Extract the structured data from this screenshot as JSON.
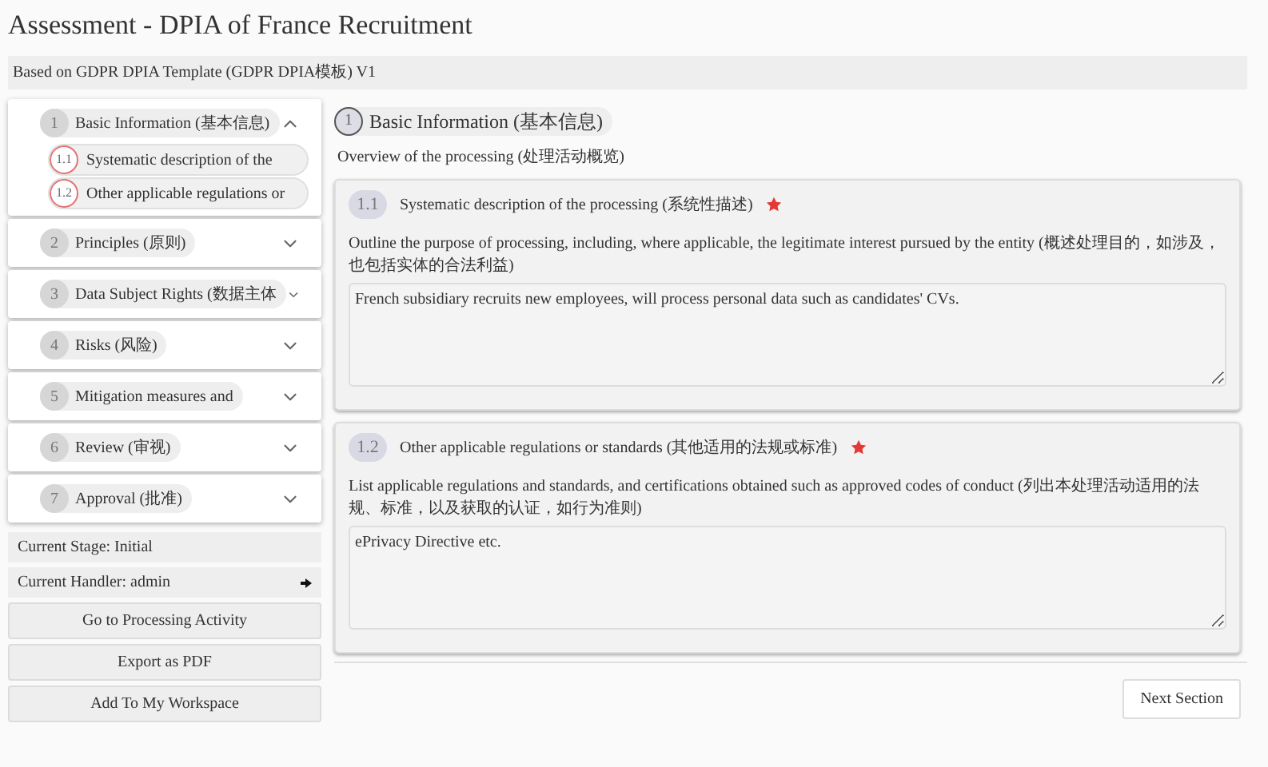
{
  "page": {
    "title": "Assessment - DPIA of France Recruitment",
    "template": "Based on GDPR DPIA Template (GDPR DPIA模板) V1"
  },
  "sections": [
    {
      "number": "1",
      "label": "Basic Information (基本信息)",
      "expanded": true,
      "children": [
        {
          "number": "1.1",
          "label": "Systematic description of the"
        },
        {
          "number": "1.2",
          "label": "Other applicable regulations or"
        }
      ]
    },
    {
      "number": "2",
      "label": "Principles (原则)",
      "expanded": false
    },
    {
      "number": "3",
      "label": "Data Subject Rights (数据主体",
      "expanded": false
    },
    {
      "number": "4",
      "label": "Risks (风险)",
      "expanded": false
    },
    {
      "number": "5",
      "label": "Mitigation measures and",
      "expanded": false
    },
    {
      "number": "6",
      "label": "Review (审视)",
      "expanded": false
    },
    {
      "number": "7",
      "label": "Approval (批准)",
      "expanded": false
    }
  ],
  "status": {
    "stage": "Current Stage: Initial",
    "handler": "Current Handler: admin"
  },
  "actions": [
    "Go to Processing Activity",
    "Export as PDF",
    "Add To My Workspace"
  ],
  "main": {
    "number": "1",
    "title": "Basic Information (基本信息)",
    "subtitle": "Overview of the processing (处理活动概览)",
    "questions": [
      {
        "number": "1.1",
        "title": "Systematic description of the processing (系统性描述)",
        "required": true,
        "description": "Outline the purpose of processing, including, where applicable, the legitimate interest pursued by the entity (概述处理目的，如涉及，也包括实体的合法利益)",
        "value": "French subsidiary recruits new employees, will process personal data such as candidates' CVs."
      },
      {
        "number": "1.2",
        "title": "Other applicable regulations or standards (其他适用的法规或标准)",
        "required": true,
        "description": "List applicable regulations and standards, and certifications obtained such as approved codes of conduct (列出本处理活动适用的法规、标准，以及获取的认证，如行为准则)",
        "value": "ePrivacy Directive etc."
      }
    ],
    "next": "Next Section"
  }
}
